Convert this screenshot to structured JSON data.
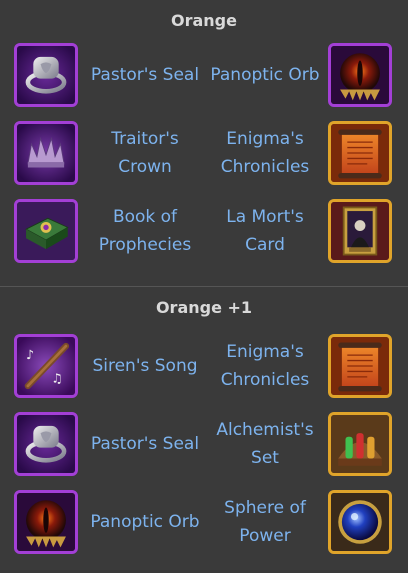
{
  "sections": [
    {
      "title": "Orange",
      "rows": [
        {
          "left": {
            "label": "Pastor's Seal",
            "icon": "pastors-seal-icon",
            "frame": "#a33fd6"
          },
          "right": {
            "label": "Panoptic Orb",
            "icon": "panoptic-orb-icon",
            "frame": "#a33fd6"
          }
        },
        {
          "left": {
            "label": "Traitor's Crown",
            "icon": "traitors-crown-icon",
            "frame": "#a33fd6"
          },
          "right": {
            "label": "Enigma's Chronicles",
            "icon": "enigmas-chronicles-icon",
            "frame": "#e0a42a"
          }
        },
        {
          "left": {
            "label": "Book of Prophecies",
            "icon": "book-of-prophecies-icon",
            "frame": "#a33fd6"
          },
          "right": {
            "label": "La Mort's Card",
            "icon": "la-morts-card-icon",
            "frame": "#e0a42a"
          }
        }
      ]
    },
    {
      "title": "Orange +1",
      "rows": [
        {
          "left": {
            "label": "Siren's Song",
            "icon": "sirens-song-icon",
            "frame": "#a33fd6"
          },
          "right": {
            "label": "Enigma's Chronicles",
            "icon": "enigmas-chronicles-icon",
            "frame": "#e0a42a"
          }
        },
        {
          "left": {
            "label": "Pastor's Seal",
            "icon": "pastors-seal-icon",
            "frame": "#a33fd6"
          },
          "right": {
            "label": "Alchemist's Set",
            "icon": "alchemists-set-icon",
            "frame": "#e0a42a"
          }
        },
        {
          "left": {
            "label": "Panoptic Orb",
            "icon": "panoptic-orb-icon",
            "frame": "#a33fd6"
          },
          "right": {
            "label": "Sphere of Power",
            "icon": "sphere-of-power-icon",
            "frame": "#e0a42a"
          }
        }
      ]
    }
  ]
}
